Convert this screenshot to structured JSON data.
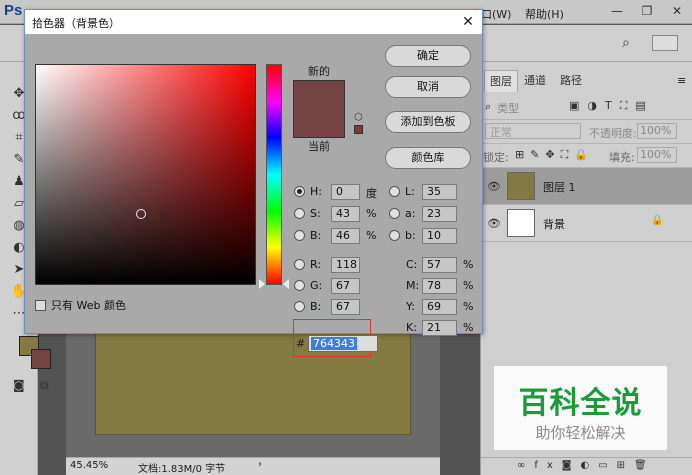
{
  "app": {
    "logo": "Ps",
    "menus_visible": [
      "窗口(W)",
      "帮助(H)"
    ],
    "window_controls": [
      "—",
      "❐",
      "✕"
    ]
  },
  "colors": {
    "selected_color": "#764343",
    "foreground": "#827a41",
    "background_swatch": "#764343",
    "dialog_bg": "#a9a9a9",
    "accent_highlight": "#3c7fd8",
    "red_outline": "#e53030"
  },
  "dialog": {
    "title": "拾色器（背景色）",
    "close": "✕",
    "new_label": "新的",
    "current_label": "当前",
    "web_only_label": "只有 Web 颜色",
    "buttons": {
      "ok": "确定",
      "cancel": "取消",
      "add_to_swatches": "添加到色板",
      "color_libraries": "颜色库"
    },
    "hsb": {
      "h_label": "H:",
      "h_value": "0",
      "h_unit": "度",
      "s_label": "S:",
      "s_value": "43",
      "s_unit": "%",
      "b_label": "B:",
      "b_value": "46",
      "b_unit": "%"
    },
    "lab": {
      "l_label": "L:",
      "l_value": "35",
      "a_label": "a:",
      "a_value": "23",
      "b_label": "b:",
      "b_value": "10"
    },
    "rgb": {
      "r_label": "R:",
      "r_value": "118",
      "g_label": "G:",
      "g_value": "67",
      "b_label": "B:",
      "b_value": "67"
    },
    "cmyk": {
      "c_label": "C:",
      "c_value": "57",
      "c_unit": "%",
      "m_label": "M:",
      "m_value": "78",
      "m_unit": "%",
      "y_label": "Y:",
      "y_value": "69",
      "y_unit": "%",
      "k_label": "K:",
      "k_value": "21",
      "k_unit": "%"
    },
    "hex_label": "#",
    "hex_value": "764343"
  },
  "layers_panel": {
    "tabs": [
      "图层",
      "通道",
      "路径"
    ],
    "filter_label": "类型",
    "blend_mode": "正常",
    "opacity_label": "不透明度:",
    "opacity_value": "100%",
    "lock_label": "锁定:",
    "fill_label": "填充:",
    "fill_value": "100%",
    "layers": [
      {
        "name": "图层 1",
        "thumb_color": "#827a41"
      },
      {
        "name": "背景",
        "thumb_color": "#ffffff"
      }
    ]
  },
  "status": {
    "zoom": "45.45%",
    "doc_info": "文档:1.83M/0 字节"
  },
  "watermark": {
    "title": "百科全说",
    "subtitle": "助你轻松解决"
  }
}
